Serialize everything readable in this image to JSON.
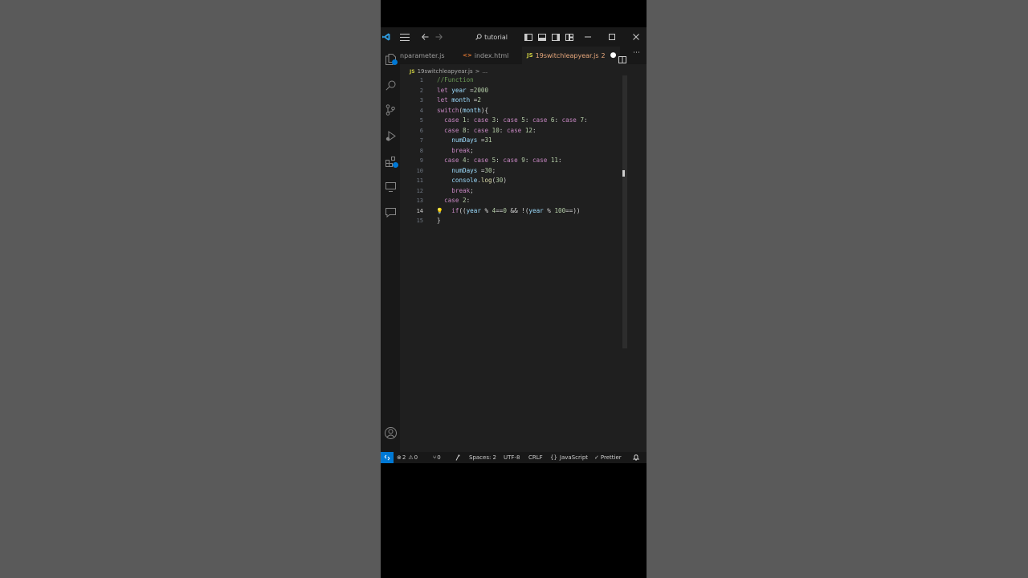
{
  "titlebar": {
    "search_text": "tutorial"
  },
  "tabs": [
    {
      "label": "nparameter.js",
      "modified": false
    },
    {
      "icon": "<>",
      "label": "index.html",
      "modified": false
    },
    {
      "icon": "JS",
      "label": "19switchleapyear.js",
      "badge": "2",
      "modified": true
    }
  ],
  "breadcrumb": {
    "icon": "JS",
    "file": "19switchleapyear.js",
    "separator": ">",
    "rest": "..."
  },
  "editor": {
    "current_line": 14,
    "lines": [
      {
        "n": "1",
        "text": "//Function"
      },
      {
        "n": "2",
        "text": "let year =2000"
      },
      {
        "n": "3",
        "text": "let month =2"
      },
      {
        "n": "4",
        "text": "switch(month){"
      },
      {
        "n": "5",
        "text": "  case 1: case 3: case 5: case 6: case 7:"
      },
      {
        "n": "6",
        "text": "  case 8: case 10: case 12:"
      },
      {
        "n": "7",
        "text": "    numDays =31"
      },
      {
        "n": "8",
        "text": "    break;"
      },
      {
        "n": "9",
        "text": "  case 4: case 5: case 9: case 11:"
      },
      {
        "n": "10",
        "text": "    numDays =30;"
      },
      {
        "n": "11",
        "text": "    console.log(30)"
      },
      {
        "n": "12",
        "text": "    break;"
      },
      {
        "n": "13",
        "text": "  case 2:"
      },
      {
        "n": "14",
        "text": "    if((year % 4==0 && !(year % 100==))"
      },
      {
        "n": "15",
        "text": "}"
      }
    ]
  },
  "statusbar": {
    "errors": "2",
    "warnings": "0",
    "ports": "0",
    "spaces": "Spaces: 2",
    "encoding": "UTF-8",
    "eol": "CRLF",
    "language": "JavaScript",
    "formatter": "Prettier"
  },
  "colors": {
    "editor_bg": "#1f1f1f",
    "chrome_bg": "#181818",
    "accent": "#0078d4",
    "keyword": "#c586c0",
    "variable": "#9cdcfe",
    "number": "#b5cea8",
    "comment": "#6a9955",
    "modified_tab": "#e8a87c"
  }
}
